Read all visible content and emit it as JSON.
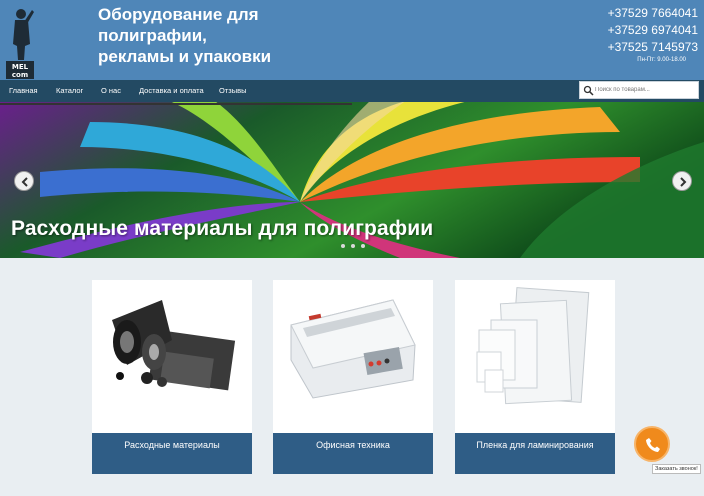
{
  "header": {
    "logo_text": "MEL com",
    "title_lines": [
      "Оборудование для",
      "полиграфии,",
      "рекламы и упаковки"
    ],
    "phones": [
      "+37529 7664041",
      "+37529 6974041",
      "+37525 7145973"
    ],
    "hours": "Пн-Пт: 9.00-18.00"
  },
  "nav": {
    "items": [
      "Главная",
      "Каталог",
      "О нас",
      "Доставка и оплата",
      "Отзывы"
    ],
    "search_placeholder": "Поиск по товарам..."
  },
  "slider": {
    "caption": "Расходные материалы для полиграфии",
    "dots_count": 3
  },
  "cards": [
    {
      "label": "Расходные материалы"
    },
    {
      "label": "Офисная техника"
    },
    {
      "label": "Пленка для ламинирования"
    }
  ],
  "callback": {
    "tooltip": "Заказать звонок!"
  },
  "colors": {
    "header_bg": "#4f86b8",
    "nav_bg": "#234a63",
    "card_label_bg": "#2f5d86",
    "call_button": "#f08a1c"
  },
  "icons": [
    "search-icon",
    "chevron-left-icon",
    "chevron-right-icon",
    "phone-icon"
  ]
}
